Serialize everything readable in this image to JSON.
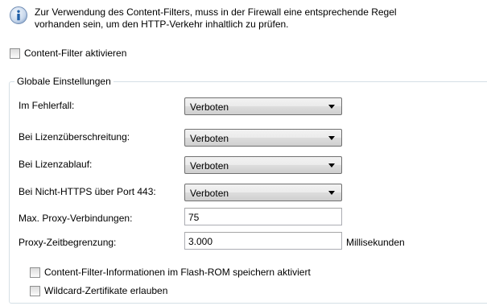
{
  "info": {
    "icon": "info-icon",
    "line1": "Zur Verwendung des Content-Filters, muss in der Firewall eine entsprechende Regel",
    "line2": "vorhanden sein, um den HTTP-Verkehr inhaltlich zu prüfen."
  },
  "enable_checkbox": {
    "label": "Content-Filter aktivieren",
    "checked": false
  },
  "global_settings": {
    "title": "Globale Einstellungen",
    "rows": [
      {
        "label": "Im Fehlerfall:",
        "value": "Verboten"
      },
      {
        "label": "Bei Lizenzüberschreitung:",
        "value": "Verboten"
      },
      {
        "label": "Bei Lizenzablauf:",
        "value": "Verboten"
      },
      {
        "label": "Bei Nicht-HTTPS über Port 443:",
        "value": "Verboten"
      },
      {
        "label": "Max. Proxy-Verbindungen:",
        "value": "75"
      },
      {
        "label": "Proxy-Zeitbegrenzung:",
        "value": "3.000",
        "unit": "Millisekunden"
      }
    ],
    "flash_checkbox": {
      "label": "Content-Filter-Informationen im Flash-ROM speichern aktiviert",
      "checked": false
    },
    "wildcard_checkbox": {
      "label": "Wildcard-Zertifikate erlauben",
      "checked": false
    }
  },
  "colors": {
    "info_icon_blue": "#1f5fa8",
    "group_border": "#d5dfe5"
  }
}
